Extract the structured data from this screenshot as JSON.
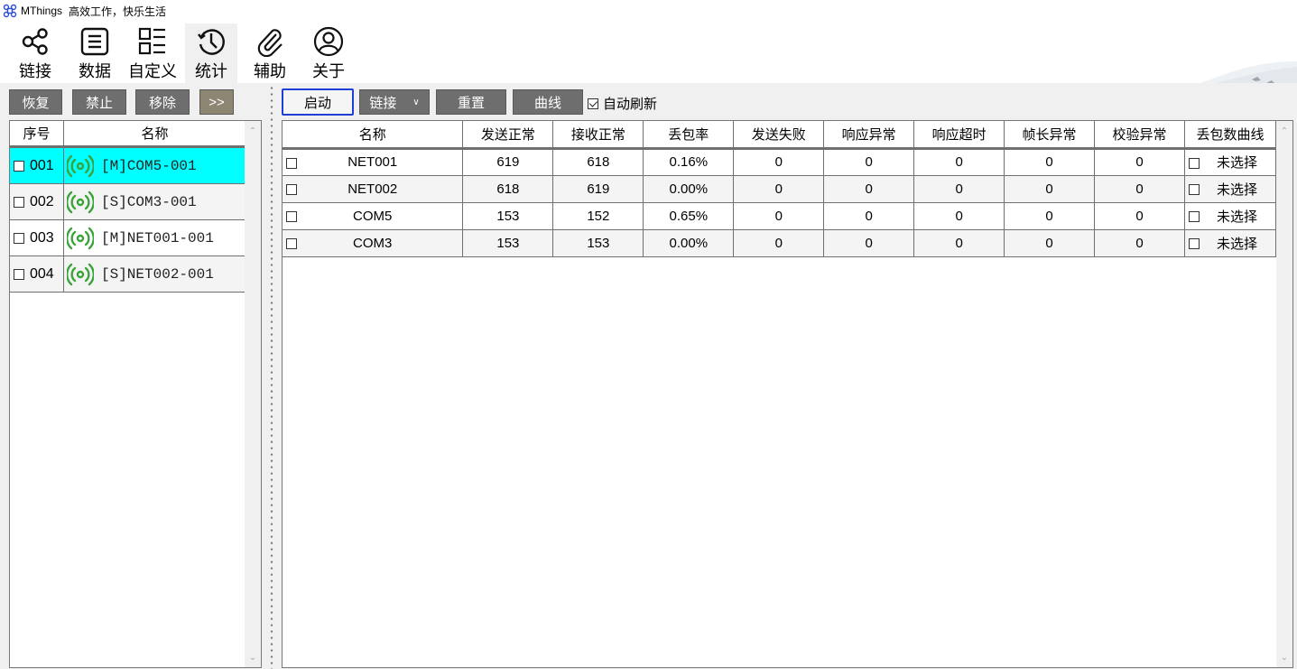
{
  "window": {
    "app_name": "MThings",
    "slogan": "高效工作，快乐生活"
  },
  "toolbar": {
    "items": [
      {
        "label": "链接",
        "icon": "share-icon",
        "active": false
      },
      {
        "label": "数据",
        "icon": "list-box-icon",
        "active": false
      },
      {
        "label": "自定义",
        "icon": "custom-layout-icon",
        "active": false
      },
      {
        "label": "统计",
        "icon": "history-clock-icon",
        "active": true
      },
      {
        "label": "辅助",
        "icon": "paperclip-icon",
        "active": false
      },
      {
        "label": "关于",
        "icon": "user-circle-icon",
        "active": false
      }
    ]
  },
  "left": {
    "buttons": {
      "restore": "恢复",
      "disable": "禁止",
      "remove": "移除",
      "expand": ">>"
    },
    "columns": [
      "序号",
      "名称"
    ],
    "rows": [
      {
        "index": "001",
        "name": "[M]COM5-001",
        "selected": true,
        "status_icon": "signal-broadcast-icon"
      },
      {
        "index": "002",
        "name": "[S]COM3-001",
        "selected": false,
        "status_icon": "signal-broadcast-icon"
      },
      {
        "index": "003",
        "name": "[M]NET001-001",
        "selected": false,
        "status_icon": "signal-broadcast-icon"
      },
      {
        "index": "004",
        "name": "[S]NET002-001",
        "selected": false,
        "status_icon": "signal-broadcast-icon"
      }
    ]
  },
  "right": {
    "buttons": {
      "start": "启动",
      "link": "链接",
      "reset": "重置",
      "curve": "曲线"
    },
    "auto_refresh": {
      "label": "自动刷新",
      "checked": true
    },
    "columns": [
      "名称",
      "发送正常",
      "接收正常",
      "丢包率",
      "发送失败",
      "响应异常",
      "响应超时",
      "帧长异常",
      "校验异常",
      "丢包数曲线"
    ],
    "rows": [
      {
        "name": "NET001",
        "send_ok": "619",
        "recv_ok": "618",
        "loss_rate": "0.16%",
        "send_fail": "0",
        "resp_err": "0",
        "resp_timeout": "0",
        "frame_len_err": "0",
        "checksum_err": "0",
        "curve": "未选择"
      },
      {
        "name": "NET002",
        "send_ok": "618",
        "recv_ok": "619",
        "loss_rate": "0.00%",
        "send_fail": "0",
        "resp_err": "0",
        "resp_timeout": "0",
        "frame_len_err": "0",
        "checksum_err": "0",
        "curve": "未选择"
      },
      {
        "name": "COM5",
        "send_ok": "153",
        "recv_ok": "152",
        "loss_rate": "0.65%",
        "send_fail": "0",
        "resp_err": "0",
        "resp_timeout": "0",
        "frame_len_err": "0",
        "checksum_err": "0",
        "curve": "未选择"
      },
      {
        "name": "COM3",
        "send_ok": "153",
        "recv_ok": "153",
        "loss_rate": "0.00%",
        "send_fail": "0",
        "resp_err": "0",
        "resp_timeout": "0",
        "frame_len_err": "0",
        "checksum_err": "0",
        "curve": "未选择"
      }
    ]
  },
  "colors": {
    "selected_row": "#00ffff",
    "signal_green": "#3aa43a",
    "start_border": "#1f3fd8",
    "button_gray": "#6e6e6e",
    "button_khaki": "#8c8672"
  }
}
